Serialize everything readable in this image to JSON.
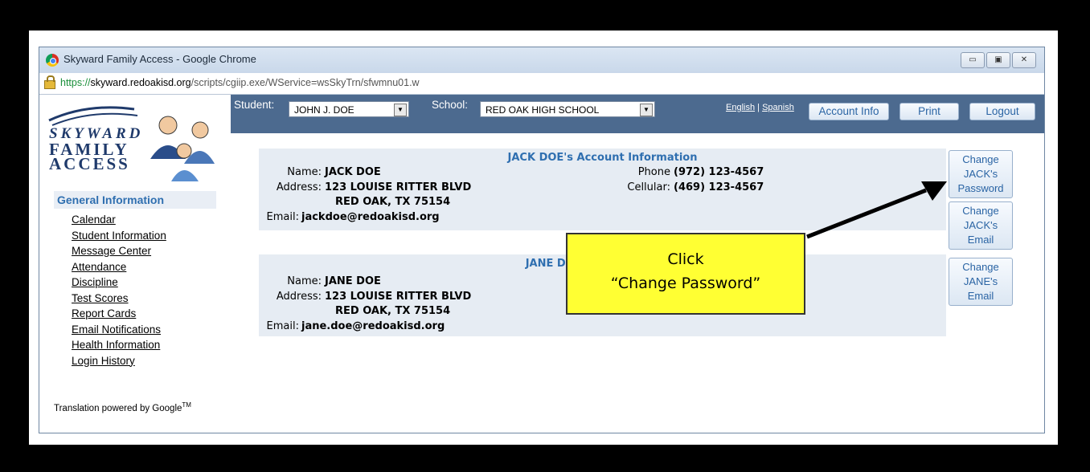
{
  "window": {
    "title": "Skyward Family Access - Google Chrome",
    "url_scheme": "https://",
    "url_host": "skyward.redoakisd.org",
    "url_path": "/scripts/cgiip.exe/WService=wsSkyTrn/sfwmnu01.w",
    "controls": [
      "▭",
      "▣",
      "✕"
    ]
  },
  "logo": {
    "line1": "SKYWARD",
    "line2": "FAMILY",
    "line3": "ACCESS"
  },
  "sidebar": {
    "header": "General Information",
    "items": [
      "Calendar",
      "Student Information",
      "Message Center",
      "Attendance",
      "Discipline",
      "Test Scores",
      "Report Cards",
      "Email Notifications",
      "Health Information",
      "Login History"
    ],
    "translation": "Translation powered by Google",
    "translation_tm": "TM"
  },
  "topbar": {
    "student_label": "Student:",
    "student_value": "JOHN J. DOE",
    "school_label": "School:",
    "school_value": "RED OAK HIGH SCHOOL",
    "lang_english": "English",
    "lang_sep": " | ",
    "lang_spanish": "Spanish",
    "account_info": "Account Info",
    "print": "Print",
    "logout": "Logout",
    "bar_color": "#4c6a8f"
  },
  "accounts": [
    {
      "header": "JACK DOE's Account Information",
      "name_label": "Name:",
      "name": "JACK DOE",
      "address_label": "Address:",
      "address1": "123 LOUISE RITTER BLVD",
      "address2": "RED OAK, TX 75154",
      "email_label": "Email:",
      "email": "jackdoe@redoakisd.org",
      "phone_label": "Phone",
      "phone": "(972) 123-4567",
      "cell_label": "Cellular:",
      "cell": "(469) 123-4567"
    },
    {
      "header": "JANE DOE's",
      "name_label": "Name:",
      "name": "JANE DOE",
      "address_label": "Address:",
      "address1": "123 LOUISE RITTER BLVD",
      "address2": "RED OAK, TX 75154",
      "email_label": "Email:",
      "email": "jane.doe@redoakisd.org"
    }
  ],
  "side_buttons": {
    "jack_password": [
      "Change",
      "JACK's",
      "Password"
    ],
    "jack_email": [
      "Change",
      "JACK's",
      "Email"
    ],
    "jane_email": [
      "Change",
      "JANE's",
      "Email"
    ]
  },
  "callout": {
    "line1": "Click",
    "line2": "“Change Password”",
    "bg": "#ffff33"
  }
}
